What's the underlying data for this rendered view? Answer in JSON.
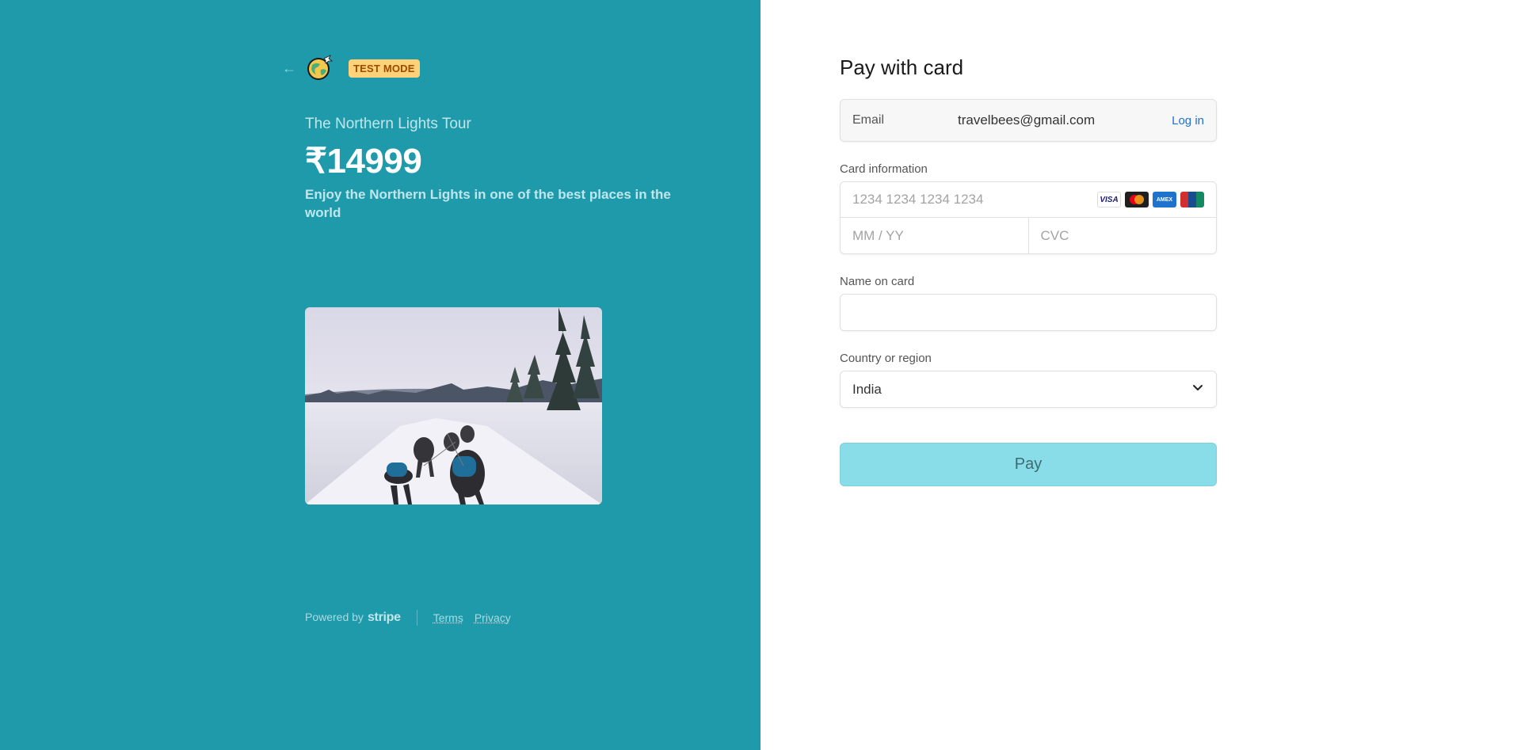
{
  "header": {
    "back_icon": "arrow-left-icon",
    "logo_icon": "globe-airplane-logo",
    "test_badge": "TEST MODE"
  },
  "product": {
    "name": "The Northern Lights Tour",
    "price": "₹14999",
    "description": "Enjoy the Northern Lights in one of the best places in the world",
    "image_alt": "Dog sled team running through a snowy forest trail"
  },
  "footer": {
    "powered_by": "Powered by",
    "brand": "stripe",
    "terms": "Terms",
    "privacy": "Privacy"
  },
  "form": {
    "title": "Pay with card",
    "email": {
      "label": "Email",
      "value": "travelbees@gmail.com",
      "login_link": "Log in"
    },
    "card": {
      "label": "Card information",
      "number_placeholder": "1234 1234 1234 1234",
      "expiry_placeholder": "MM / YY",
      "cvc_placeholder": "CVC",
      "brands": [
        "VISA",
        "Mastercard",
        "AMEX",
        "UnionPay"
      ]
    },
    "name": {
      "label": "Name on card",
      "value": ""
    },
    "country": {
      "label": "Country or region",
      "value": "India"
    },
    "pay_button": "Pay"
  },
  "colors": {
    "left_panel_bg": "#1f9aab",
    "pay_button_bg": "#88dde9",
    "badge_bg": "#ffd27a",
    "link": "#1f6fd6"
  }
}
